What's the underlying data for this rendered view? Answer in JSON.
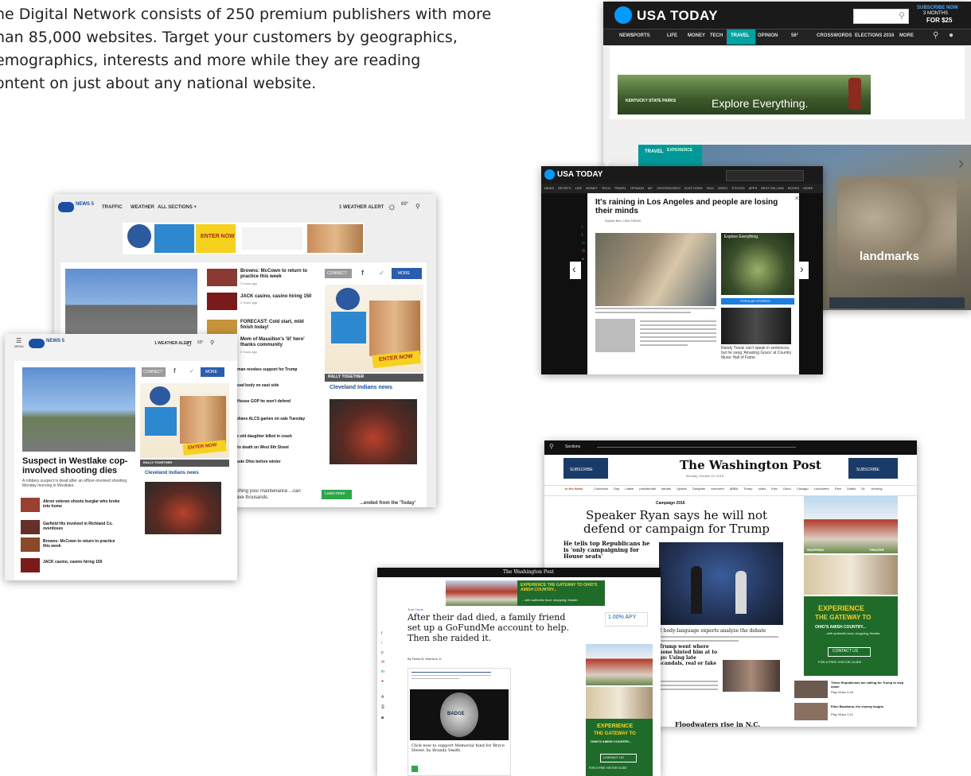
{
  "intro": {
    "line1": "he Digital Network consists of 250 premium publishers with more",
    "line2": "han 85,000 websites. Target your customers by geographics,",
    "line3": "emographics, interests and more while they are reading",
    "line4": "ontent on just about any national website."
  },
  "usatoday_main": {
    "logo": "USA TODAY",
    "subscribe": "SUBSCRIBE NOW",
    "subscribe2": "3 MONTHS",
    "subscribe3": "FOR $25",
    "nav": [
      "NEWS",
      "SPORTS",
      "LIFE",
      "MONEY",
      "TECH",
      "TRAVEL",
      "OPINION",
      "56°",
      "CROSSWORDS",
      "ELECTIONS 2016",
      "MORE"
    ],
    "ad_brand": "KENTUCKY STATE PARKS",
    "ad_tag": "Explore Everything.",
    "hero_label": "TRAVEL",
    "hero_label2": "EXPERIENCE",
    "hero_text": "landmarks"
  },
  "usatoday_article": {
    "logo": "USA TODAY",
    "nav": [
      "NEWS",
      "SPORTS",
      "LIFE",
      "MONEY",
      "TECH",
      "TRAVEL",
      "OPINION",
      "56°",
      "CROSSWORDS",
      "ELECTIONS 2016",
      "VIDEO",
      "STOCKS",
      "APPS",
      "BEST-SELLING BOOKS",
      "MORE"
    ],
    "headline": "It's raining in Los Angeles and people are losing their minds",
    "byline": "Sophie Brin, USA TODAY",
    "side_ad": "Explore Everything.",
    "popular": "POPULAR STORIES",
    "side_story": "Randy Travis can't speak in sentences, but he sang 'Amazing Grace' at Country Music Hall of Fame"
  },
  "news5_back": {
    "logo": "NEWS 5",
    "nav": [
      "TRAFFIC",
      "WEATHER",
      "ALL SECTIONS +"
    ],
    "alert": "1 WEATHER ALERT",
    "temp": "69°",
    "ad_cta": "ENTER NOW",
    "ad_title": "PERRYSBURG WEEKEND GETAWAY SWEEPSTAKES",
    "stories": [
      "Browns: McCown to return to practice this week",
      "JACK casino, casino hiring 150",
      "FORECAST: Cold start, mild finish today!",
      "Mom of Massillon's 'lil' hero' thanks community"
    ],
    "times": [
      "2 hours ago",
      "2 hours ago",
      "",
      "2 hours ago"
    ],
    "connect": "CONNECT",
    "more": "MORE",
    "rally": "RALLY TOGETHER",
    "cleveland": "Cleveland Indians news",
    "list": [
      "...man revokes support for Trump",
      "...ead body on east side",
      "...House GOP he won't defend",
      "...dians ALCS games on sale Tuesday",
      "...r-old daughter killed in crash",
      "...to death on West 6th Street",
      "...ude Ohio before winter"
    ],
    "maint": "...thing your maintenance ...can save thousands.",
    "learn": "Learn more",
    "ended": "...ended from the 'Today'"
  },
  "news5_front": {
    "menu": "MENU",
    "logo": "NEWS 5",
    "alert": "1 WEATHER ALERT",
    "temp": "69°",
    "connect": "CONNECT",
    "more": "MORE",
    "headline": "Suspect in Westlake cop-involved shooting dies",
    "summary": "A robbery suspect is dead after an officer-involved shooting Monday morning in Westlake.",
    "rally": "RALLY TOGETHER",
    "cleveland": "Cleveland Indians news",
    "ad_cta": "ENTER NOW",
    "stories": [
      "Akron veteran shoots burglar who broke into home",
      "Garfield Hts involved in Richland Co. overdoses",
      "Browns: McCown to return to practice this week",
      "JACK casino, casino hiring 150"
    ]
  },
  "wapo_main": {
    "sections": "Sections",
    "masthead": "The Washington Post",
    "date": "Monday, October 10, 2016",
    "subscribe": "SUBSCRIBE",
    "nav_first": "In the News",
    "nav": [
      "Columbus Day",
      "Latest presidential debate",
      "Upside",
      "Daughter executed",
      "ABBA",
      "Trump video",
      "Kiev Dunn",
      "Chicago",
      "Londoners",
      "Pam Zadek Dr. Horning"
    ],
    "kicker": "Campaign 2016",
    "headline": "Speaker Ryan says he will not defend or campaign for Trump",
    "sub": "He tells top Republicans he is 'only campaigning for House seats'",
    "story2": "2 body-language experts analyze the debate",
    "story3": "Trump went where none hinted him at to go: Using late scandals, real or fake",
    "story4": "Floodwaters rise in N.C.",
    "ad_experience": "EXPERIENCE",
    "ad_gateway": "THE GATEWAY TO",
    "ad_country": "OHIO'S AMISH COUNTRY...",
    "ad_sub": "...with authentic food, shopping, theater.",
    "ad_contact": "CONTACT US",
    "ad_guide": "FOR A FREE VISITOR GUIDE",
    "ad_shopping": "SHOPPING",
    "ad_theater": "THEATER",
    "side1": "These Republicans are calling for Trump to step down",
    "side1b": "Play Video 2:40",
    "side2": "Ellen Barakuna, the clumsy laughs",
    "side2b": "Play Video 1:11"
  },
  "wapo_article": {
    "masthead": "The Washington Post",
    "banner_title": "EXPERIENCE THE GATEWAY TO OHIO'S AMISH COUNTRY...",
    "banner_sub": "...with authentic food, shopping, theater.",
    "apy": "1.00% APY",
    "kicker": "True Crime",
    "headline": "After their dad died, a family friend set up a GoFundMe account to help. Then she raided it.",
    "byline": "By Derek B. Morrison Jr.",
    "caption": "Click now to support Memorial fund for Bryce Dieter, by Brandy Smith",
    "badge": "BADGE",
    "ad_experience": "EXPERIENCE",
    "ad_gateway": "THE GATEWAY TO",
    "ad_country": "OHIO'S AMISH COUNTRY...",
    "ad_contact": "CONTACT US",
    "ad_guide": "FOR A FREE VISITOR GUIDE"
  }
}
